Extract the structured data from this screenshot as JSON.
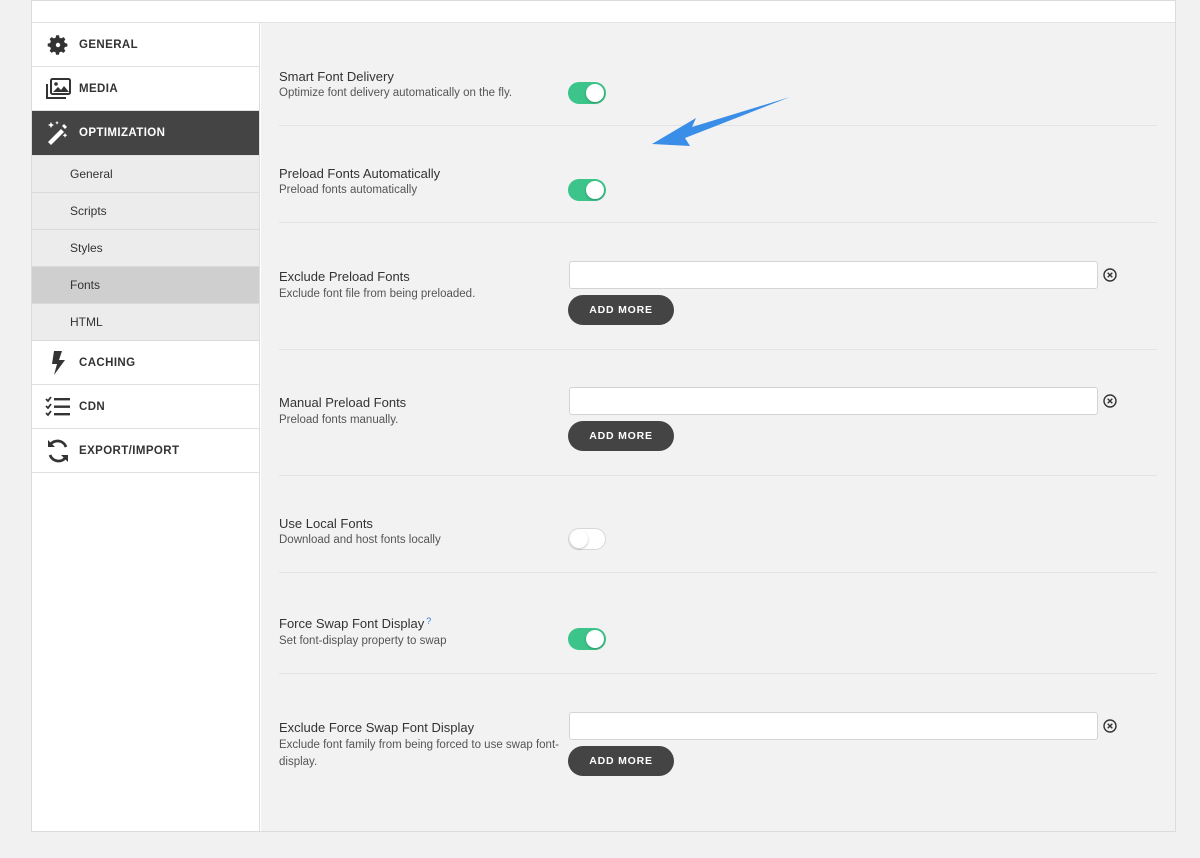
{
  "sidebar": {
    "items": [
      {
        "label": "GENERAL",
        "icon": "gear-icon"
      },
      {
        "label": "MEDIA",
        "icon": "image-icon"
      },
      {
        "label": "OPTIMIZATION",
        "icon": "magic-wand-icon",
        "active": true
      },
      {
        "label": "CACHING",
        "icon": "bolt-icon"
      },
      {
        "label": "CDN",
        "icon": "checklist-icon"
      },
      {
        "label": "EXPORT/IMPORT",
        "icon": "sync-icon"
      }
    ],
    "subitems": [
      {
        "label": "General"
      },
      {
        "label": "Scripts"
      },
      {
        "label": "Styles"
      },
      {
        "label": "Fonts",
        "active": true
      },
      {
        "label": "HTML"
      }
    ]
  },
  "settings": {
    "smart_font_delivery": {
      "title": "Smart Font Delivery",
      "desc": "Optimize font delivery automatically on the fly.",
      "enabled": true
    },
    "preload_fonts_auto": {
      "title": "Preload Fonts Automatically",
      "desc": "Preload fonts automatically",
      "enabled": true
    },
    "exclude_preload_fonts": {
      "title": "Exclude Preload Fonts",
      "desc": "Exclude font file from being preloaded.",
      "value": "",
      "add_label": "ADD MORE"
    },
    "manual_preload_fonts": {
      "title": "Manual Preload Fonts",
      "desc": "Preload fonts manually.",
      "value": "",
      "add_label": "ADD MORE"
    },
    "use_local_fonts": {
      "title": "Use Local Fonts",
      "desc": "Download and host fonts locally",
      "enabled": false
    },
    "force_swap_font_display": {
      "title": "Force Swap Font Display",
      "help": "?",
      "desc": "Set font-display property to swap",
      "enabled": true
    },
    "exclude_force_swap": {
      "title": "Exclude Force Swap Font Display",
      "desc": "Exclude font family from being forced to use swap font-display.",
      "value": "",
      "add_label": "ADD MORE"
    }
  },
  "colors": {
    "toggle_on": "#3cc48a",
    "active_nav": "#444444",
    "annotation_arrow": "#3a8ee8"
  }
}
